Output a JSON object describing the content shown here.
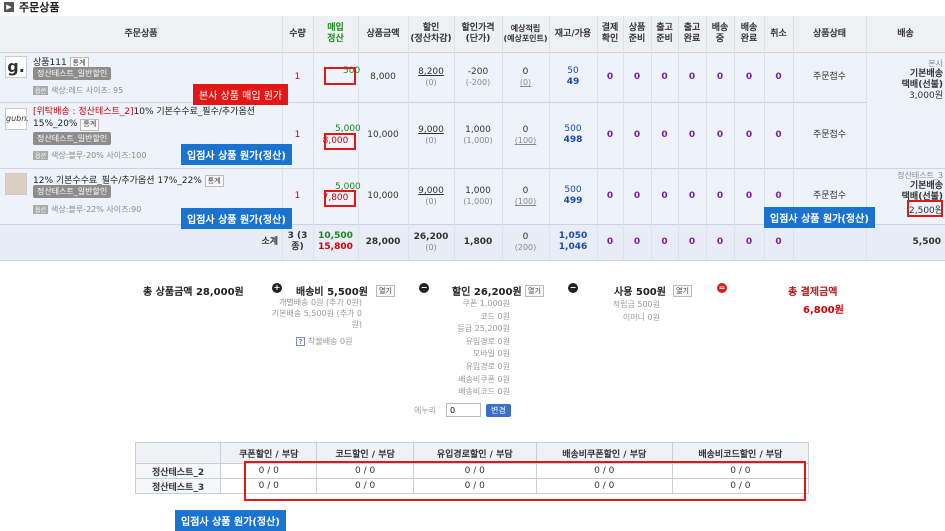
{
  "title": "주문상품",
  "headers": [
    "주문상품",
    "수량",
    "매입\n정산",
    "상품금액",
    "할인\n(정산차감)",
    "할인가격\n(단가)",
    "예상적립\n(예상포인트)",
    "재고/가용",
    "결제\n확인",
    "상품\n준비",
    "출고\n준비",
    "출고\n완료",
    "배송\n중",
    "배송\n완료",
    "취소",
    "상품상태",
    "배송"
  ],
  "rows": [
    {
      "name": "상품111",
      "stats_btn": "통계",
      "supplier_btn": "정산테스트_일반할인",
      "option": "색상:레드 사이즈: 95",
      "option_chip": "옵션",
      "qty": "1",
      "purchase_top": "500",
      "purchase": "",
      "price": "8,000",
      "discount": "8,200",
      "discount_sub": "(0)",
      "disc_price": "-200",
      "disc_price_sub": "(-200)",
      "points": "0",
      "points_sub": "(0)",
      "stock": "50",
      "avail": "49",
      "s1": "0",
      "s2": "0",
      "s3": "0",
      "s4": "0",
      "s5": "0",
      "s6": "0",
      "s7": "0",
      "status": "주문접수"
    },
    {
      "name_tag": "[위탁배송 : 정산테스트_2]",
      "name": "10% 기본수수료_필수/추가옵션 15%_20%",
      "stats_btn": "통계",
      "supplier_btn": "정산테스트_일반할인",
      "option": "색상:블루-20% 사이즈:100",
      "option_chip": "옵션",
      "qty": "1",
      "purchase_top": "5,000",
      "purchase": "8,000",
      "price": "10,000",
      "discount": "9,000",
      "discount_sub": "(0)",
      "disc_price": "1,000",
      "disc_price_sub": "(1,000)",
      "points": "0",
      "points_sub": "(100)",
      "stock": "500",
      "avail": "498",
      "s1": "0",
      "s2": "0",
      "s3": "0",
      "s4": "0",
      "s5": "0",
      "s6": "0",
      "s7": "0",
      "status": "주문접수"
    },
    {
      "name": "12% 기본수수료_필수/추가옵션 17%_22%",
      "stats_btn": "통계",
      "supplier_btn": "정산테스트_일반할인",
      "option": "색상:블루-22% 사이즈:90",
      "option_chip": "옵션",
      "qty": "1",
      "purchase_top": "5,000",
      "purchase": "7,800",
      "price": "10,000",
      "discount": "9,000",
      "discount_sub": "(0)",
      "disc_price": "1,000",
      "disc_price_sub": "(1,000)",
      "points": "0",
      "points_sub": "(100)",
      "stock": "500",
      "avail": "499",
      "s1": "0",
      "s2": "0",
      "s3": "0",
      "s4": "0",
      "s5": "0",
      "s6": "0",
      "s7": "0",
      "status": "주문접수"
    }
  ],
  "shipping": {
    "group1": [
      "본사",
      "기본배송",
      "택배(선불)",
      "3,000원"
    ],
    "group2": [
      "정산테스트_3",
      "기본배송",
      "택배(선불)"
    ],
    "group2_value": "2,500원"
  },
  "subtotal": {
    "label": "소계",
    "qty": "3 (3종)",
    "purchase_a": "10,500",
    "purchase_b": "15,800",
    "price": "28,000",
    "discount": "26,200",
    "discount_sub": "(0)",
    "disc_price": "1,800",
    "points": "0",
    "points_sub": "(200)",
    "stock": "1,050",
    "avail": "1,046",
    "s1": "0",
    "s2": "0",
    "s3": "0",
    "s4": "0",
    "s5": "0",
    "s6": "0",
    "s7": "0",
    "shipping": "5,500"
  },
  "callouts": {
    "hq": "본사 상품 매입 원가",
    "supplier": "입점사 상품 원가(정산)"
  },
  "summary": {
    "total_label": "총 상품금액 28,000원",
    "ship_label": "배송비 5,500원",
    "ship_details": [
      "개별배송 0원 (추가 0원)",
      "기본배송 5,500원 (추가 0",
      "원)"
    ],
    "ship_cod": "착불배송 0원",
    "disc_label": "할인 26,200원",
    "disc_details": [
      "쿠폰 1,000원",
      "코드 0원",
      "등급 25,200원",
      "유입경로 0원",
      "모바일 0원",
      "유입경로 0원",
      "배송비쿠폰 0원",
      "배송비코드 0원"
    ],
    "enuri_label": "에누리",
    "enuri_value": "0",
    "change_btn": "변경",
    "use_label": "사용 500원",
    "use_details": [
      "적립금 500원",
      "이머니 0원"
    ],
    "open_btn": "열기",
    "pay_label": "총 결제금액",
    "pay_value": "6,800원",
    "plus": "+",
    "minus": "−"
  },
  "sub_table": {
    "headers": [
      "",
      "쿠폰할인 / 부담",
      "코드할인 / 부담",
      "유입경로할인 / 부담",
      "배송비쿠폰할인 / 부담",
      "배송비코드할인 / 부담"
    ],
    "rows": [
      [
        "정산테스트_2",
        "0 / 0",
        "0 / 0",
        "0 / 0",
        "0 / 0",
        "0 / 0"
      ],
      [
        "정산테스트_3",
        "0 / 0",
        "0 / 0",
        "0 / 0",
        "0 / 0",
        "0 / 0"
      ]
    ]
  }
}
